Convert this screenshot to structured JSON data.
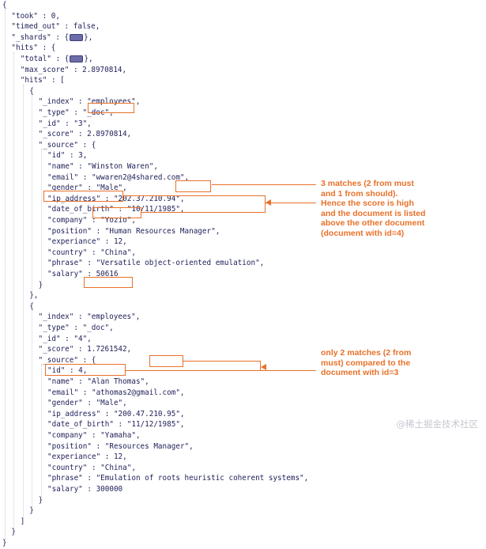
{
  "json_lines": [
    {
      "indent": 0,
      "text": "{"
    },
    {
      "indent": 1,
      "text": "\"took\" : 0,"
    },
    {
      "indent": 1,
      "text": "\"timed_out\" : false,"
    },
    {
      "indent": 1,
      "text": "\"_shards\" : {",
      "badge": true,
      "after": "},"
    },
    {
      "indent": 1,
      "text": "\"hits\" : {"
    },
    {
      "indent": 2,
      "text": "\"total\" : {",
      "badge": true,
      "after": "},"
    },
    {
      "indent": 2,
      "text": "\"max_score\" : 2.8970814,"
    },
    {
      "indent": 2,
      "text": "\"hits\" : ["
    },
    {
      "indent": 3,
      "text": "{"
    },
    {
      "indent": 4,
      "text": "\"_index\" : \"employees\","
    },
    {
      "indent": 4,
      "text": "\"_type\" : \"_doc\","
    },
    {
      "indent": 4,
      "text": "\"_id\" : \"3\","
    },
    {
      "indent": 4,
      "text": "\"_score\" : 2.8970814,"
    },
    {
      "indent": 4,
      "text": "\"_source\" : {"
    },
    {
      "indent": 5,
      "text": "\"id\" : 3,"
    },
    {
      "indent": 5,
      "text": "\"name\" : \"Winston Waren\","
    },
    {
      "indent": 5,
      "text": "\"email\" : \"wwaren2@4shared.com\","
    },
    {
      "indent": 5,
      "text": "\"gender\" : \"Male\","
    },
    {
      "indent": 5,
      "text": "\"ip_address\" : \"202.37.210.94\","
    },
    {
      "indent": 5,
      "text": "\"date_of_birth\" : \"10/11/1985\","
    },
    {
      "indent": 5,
      "text": "\"company\" : \"Yozio\","
    },
    {
      "indent": 5,
      "text": "\"position\" : \"Human Resources Manager\","
    },
    {
      "indent": 5,
      "text": "\"experiance\" : 12,"
    },
    {
      "indent": 5,
      "text": "\"country\" : \"China\","
    },
    {
      "indent": 5,
      "text": "\"phrase\" : \"Versatile object-oriented emulation\","
    },
    {
      "indent": 5,
      "text": "\"salary\" : 50616"
    },
    {
      "indent": 4,
      "text": "}"
    },
    {
      "indent": 3,
      "text": "},"
    },
    {
      "indent": 3,
      "text": "{"
    },
    {
      "indent": 4,
      "text": "\"_index\" : \"employees\","
    },
    {
      "indent": 4,
      "text": "\"_type\" : \"_doc\","
    },
    {
      "indent": 4,
      "text": "\"_id\" : \"4\","
    },
    {
      "indent": 4,
      "text": "\"_score\" : 1.7261542,"
    },
    {
      "indent": 4,
      "text": "\"_source\" : {"
    },
    {
      "indent": 5,
      "text": "\"id\" : 4,"
    },
    {
      "indent": 5,
      "text": "\"name\" : \"Alan Thomas\","
    },
    {
      "indent": 5,
      "text": "\"email\" : \"athomas2@gmail.com\","
    },
    {
      "indent": 5,
      "text": "\"gender\" : \"Male\","
    },
    {
      "indent": 5,
      "text": "\"ip_address\" : \"200.47.210.95\","
    },
    {
      "indent": 5,
      "text": "\"date_of_birth\" : \"11/12/1985\","
    },
    {
      "indent": 5,
      "text": "\"company\" : \"Yamaha\","
    },
    {
      "indent": 5,
      "text": "\"position\" : \"Resources Manager\","
    },
    {
      "indent": 5,
      "text": "\"experiance\" : 12,"
    },
    {
      "indent": 5,
      "text": "\"country\" : \"China\","
    },
    {
      "indent": 5,
      "text": "\"phrase\" : \"Emulation of roots heuristic coherent systems\","
    },
    {
      "indent": 5,
      "text": "\"salary\" : 300000"
    },
    {
      "indent": 4,
      "text": "}"
    },
    {
      "indent": 3,
      "text": "}"
    },
    {
      "indent": 2,
      "text": "]"
    },
    {
      "indent": 1,
      "text": "}"
    },
    {
      "indent": 0,
      "text": "}"
    }
  ],
  "annotations": {
    "doc3_note": "3 matches (2 from must\nand 1 from should).\nHence the score is high\nand the document is listed\nabove the other document\n(document with id=4)",
    "doc4_note": "only 2 matches (2 from\nmust) compared to the\ndocument with id=3"
  },
  "watermark": "@稀土掘金技术社区",
  "colors": {
    "code_text": "#1e1e58",
    "highlight": "#e8712a",
    "guide_lines": "#c8cdd8",
    "badge": "#6c6ca8"
  }
}
